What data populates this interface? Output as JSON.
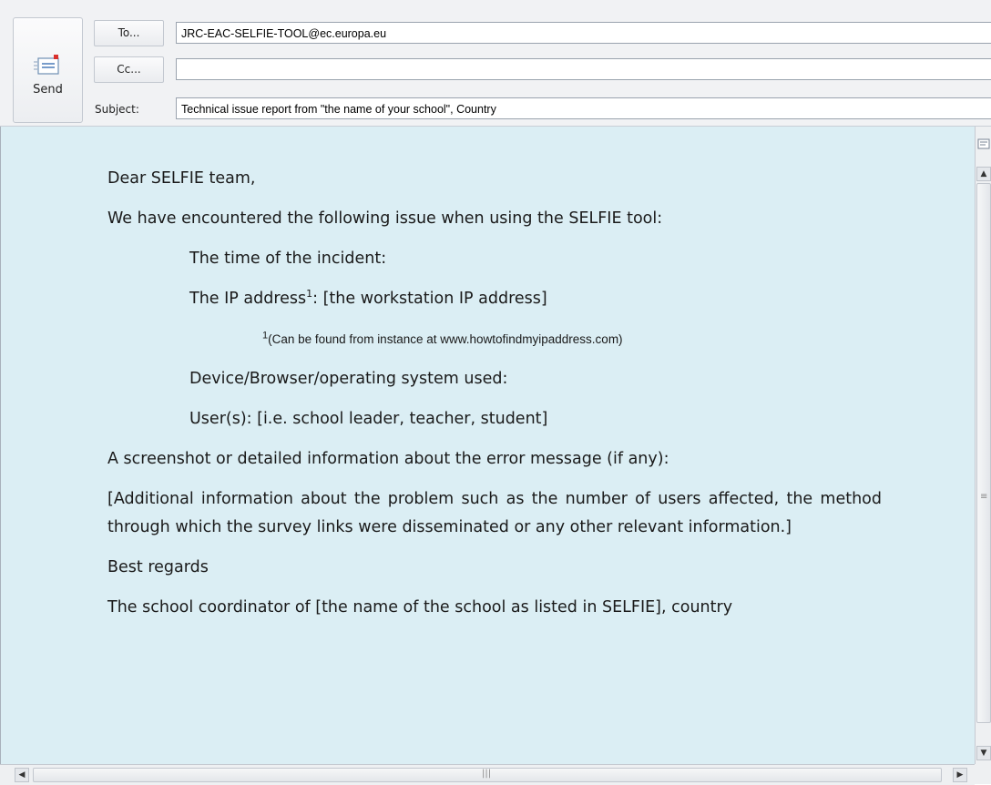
{
  "header": {
    "send_label": "Send",
    "to_label": "To...",
    "cc_label": "Cc...",
    "subject_label": "Subject:",
    "to_value": "JRC-EAC-SELFIE-TOOL@ec.europa.eu",
    "cc_value": "",
    "subject_value": "Technical issue report from \"the name of your school\", Country"
  },
  "message": {
    "greeting": "Dear SELFIE team,",
    "intro": "We have encountered the following issue when using the SELFIE tool:",
    "time": "The time of the incident:",
    "ip_prefix": "The IP address",
    "ip_sup": "1",
    "ip_suffix": ": [the workstation IP address]",
    "footnote_sup": "1",
    "footnote_text": "(Can be found from instance at www.howtofindmyipaddress.com)",
    "device": "Device/Browser/operating system used:",
    "users": "User(s): [i.e. school leader, teacher, student]",
    "screenshot": "A screenshot or detailed information about the error message (if any):",
    "additional": "[Additional information about the problem such as the number of users affected, the method through which the survey links were disseminated or any other relevant information.]",
    "regards": "Best regards",
    "signature": "The school coordinator of [the name of the school as listed in SELFIE], country"
  },
  "icons": {
    "send": "send-envelope-icon",
    "pane": "reading-pane-icon"
  },
  "colors": {
    "body_background": "#dbeef4",
    "header_background": "#f1f2f4"
  }
}
